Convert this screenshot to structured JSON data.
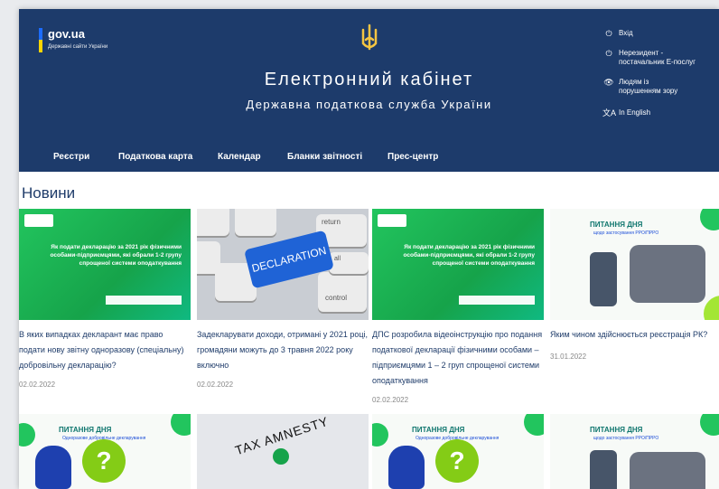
{
  "site": {
    "name": "gov.ua",
    "subtitle": "Державні сайти України"
  },
  "header": {
    "title": "Електронний кабінет",
    "subtitle": "Державна податкова служба України"
  },
  "utility": [
    {
      "icon": "login-icon",
      "label": "Вхід"
    },
    {
      "icon": "nonresident-icon",
      "label": "Нерезидент -\nпостачальник Е-послуг"
    },
    {
      "icon": "eye-icon",
      "label": "Людям із\nпорушенням зору"
    },
    {
      "icon": "translate-icon",
      "label": "In English"
    }
  ],
  "nav": [
    "Реєстри",
    "Податкова карта",
    "Календар",
    "Бланки звітності",
    "Прес-центр"
  ],
  "news": {
    "title": "Новини",
    "cards": [
      {
        "title": "В яких випадках декларант має право подати нову звітну одноразову (спеціальну) добровільну декларацію?",
        "date": "02.02.2022",
        "image_text": "Як подати декларацію за 2021 рік фізичними особами-підприємцями, які обрали 1-2 групу спрощеної системи оподаткування"
      },
      {
        "title": "Задекларувати доходи, отримані у 2021 році, громадяни можуть до 3 травня 2022 року включно",
        "date": "02.02.2022",
        "image_text": "DECLARATION",
        "image_keys": [
          "return",
          "control",
          "all"
        ]
      },
      {
        "title": "ДПС розробила відеоінструкцію про подання податкової декларації фізичними особами – підприємцями 1 – 2 груп спрощеної системи оподаткування",
        "date": "02.02.2022",
        "image_text": "Як подати декларацію за 2021 рік фізичними особами-підприємцями, які обрали 1-2 групу спрощеної системи оподаткування"
      },
      {
        "title": "Яким чином здійснюється реєстрація РК?",
        "date": "31.01.2022",
        "image_text": "ПИТАННЯ ДНЯ",
        "image_sub": "щодо застосування РРО/ПРРО"
      }
    ],
    "second_row": [
      {
        "image_text": "ПИТАННЯ ДНЯ",
        "image_sub": "Одноразове добровільне декларування"
      },
      {
        "image_text": "TAX AMNESTY"
      },
      {
        "image_text": "ПИТАННЯ ДНЯ",
        "image_sub": "Одноразове добровільне декларування"
      },
      {
        "image_text": "ПИТАННЯ ДНЯ",
        "image_sub": "щодо застосування РРО/ПРРО"
      }
    ]
  },
  "colors": {
    "header_bg": "#1d3b6b",
    "link_text": "#1f3c6a",
    "flag_blue": "#1c6cff",
    "flag_yellow": "#ffd500",
    "accent_green": "#22c55e"
  }
}
